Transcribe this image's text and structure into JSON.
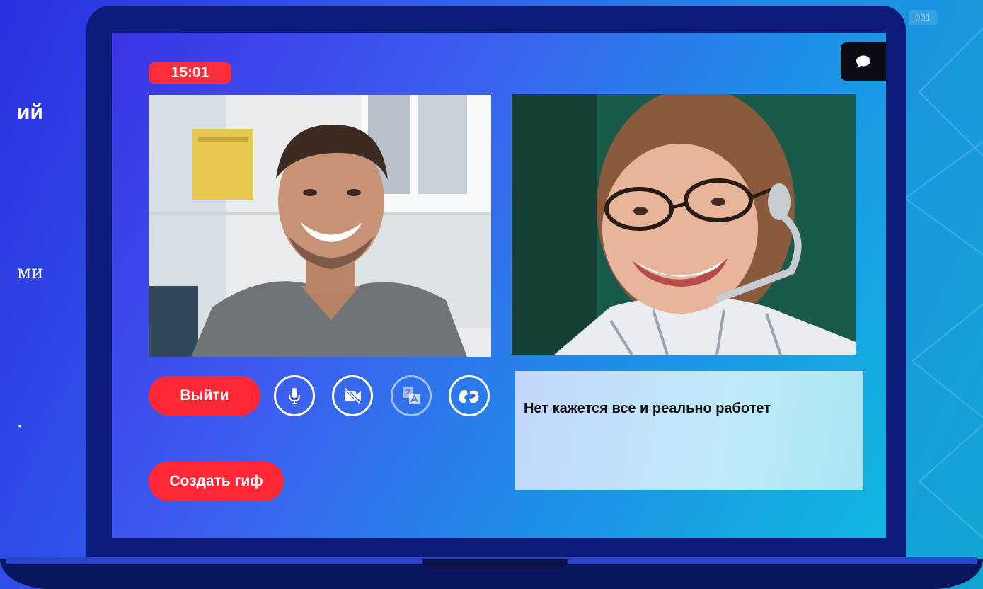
{
  "background": {
    "left_fragments": [
      "ий",
      "ми",
      "."
    ],
    "corner_badge": "001"
  },
  "call": {
    "timer": "15:01",
    "exit_label": "Выйти",
    "gif_label": "Создать гиф",
    "subtitle": "Нет кажется все и реально работет",
    "controls": {
      "mic": "microphone-icon",
      "camera": "camera-off-icon",
      "translate": "translate-icon",
      "sign": "sign-language-icon",
      "chat": "chat-bubble-icon"
    }
  },
  "colors": {
    "accent_red": "#ff2735",
    "timer_red": "#ff2e3a",
    "laptop_frame": "#0d1c78",
    "subtitle_bg": "#c4d6ff"
  }
}
